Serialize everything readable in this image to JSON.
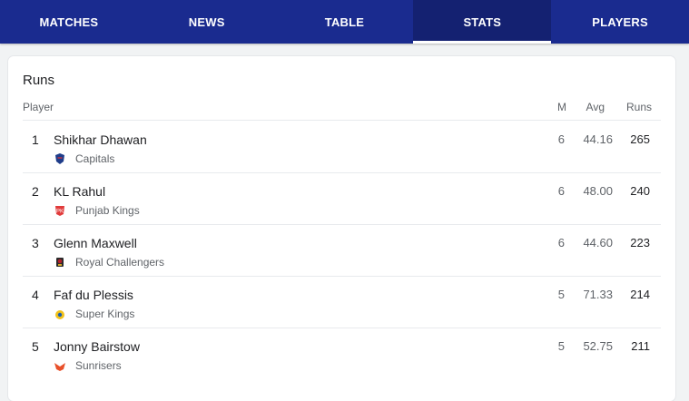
{
  "tabs": [
    {
      "label": "MATCHES"
    },
    {
      "label": "NEWS"
    },
    {
      "label": "TABLE"
    },
    {
      "label": "STATS"
    },
    {
      "label": "PLAYERS"
    }
  ],
  "stats": {
    "title": "Runs",
    "headers": {
      "player": "Player",
      "m": "M",
      "avg": "Avg",
      "runs": "Runs"
    },
    "rows": [
      {
        "rank": "1",
        "player": "Shikhar Dhawan",
        "team": "Capitals",
        "m": "6",
        "avg": "44.16",
        "runs": "265",
        "logo": "capitals-logo",
        "color": "#1f3d8a"
      },
      {
        "rank": "2",
        "player": "KL Rahul",
        "team": "Punjab Kings",
        "m": "6",
        "avg": "48.00",
        "runs": "240",
        "logo": "punjab-kings-logo",
        "color": "#e13b3b"
      },
      {
        "rank": "3",
        "player": "Glenn Maxwell",
        "team": "Royal Challengers",
        "m": "6",
        "avg": "44.60",
        "runs": "223",
        "logo": "royal-challengers-logo",
        "color": "#b5202b"
      },
      {
        "rank": "4",
        "player": "Faf du Plessis",
        "team": "Super Kings",
        "m": "5",
        "avg": "71.33",
        "runs": "214",
        "logo": "super-kings-logo",
        "color": "#f2c21b"
      },
      {
        "rank": "5",
        "player": "Jonny Bairstow",
        "team": "Sunrisers",
        "m": "5",
        "avg": "52.75",
        "runs": "211",
        "logo": "sunrisers-logo",
        "color": "#e8502a"
      }
    ]
  },
  "active_tab": "STATS"
}
